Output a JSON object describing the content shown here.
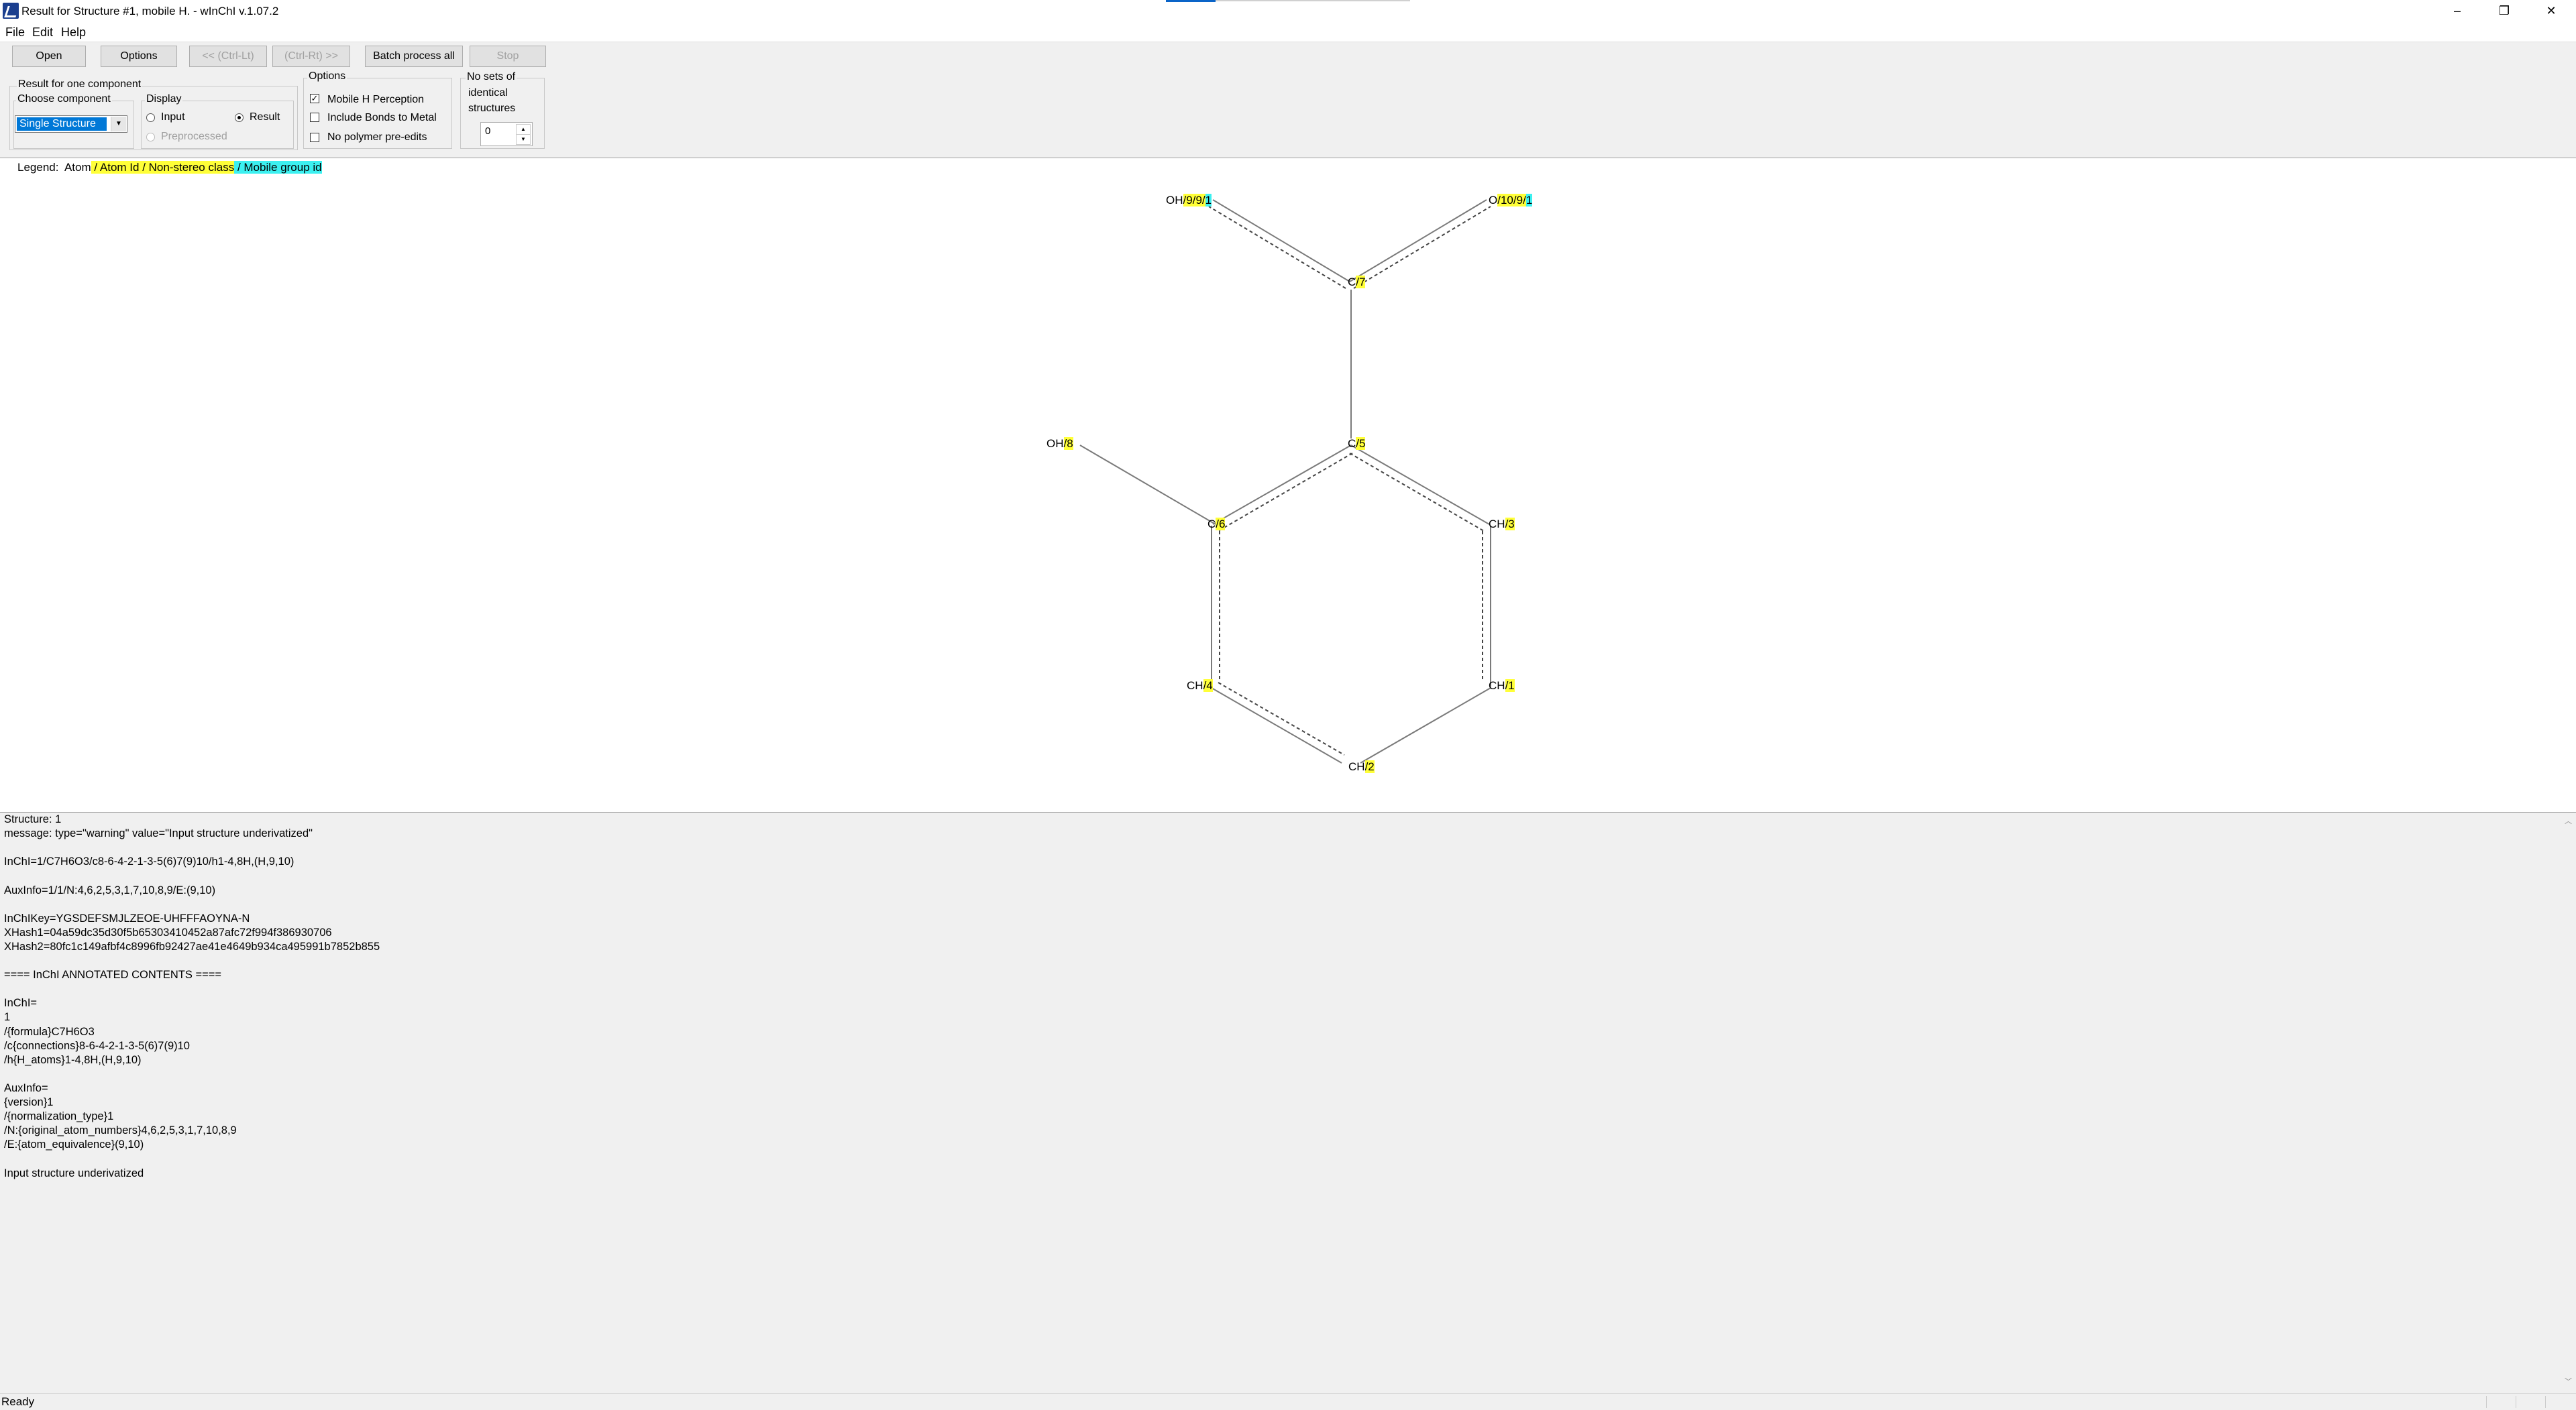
{
  "window": {
    "title": "Result for Structure #1, mobile H. - wInChI v.1.07.2",
    "minimize": "–",
    "restore": "❐",
    "close": "✕"
  },
  "menu": [
    "File",
    "Edit",
    "Help"
  ],
  "toolbar": {
    "open": "Open",
    "options": "Options",
    "prev": "<< (Ctrl-Lt)",
    "next": "(Ctrl-Rt) >>",
    "batch": "Batch process all",
    "stop": "Stop"
  },
  "result_group": {
    "title": "Result for one component",
    "choose_label": "Choose component",
    "combo_value": "Single Structure"
  },
  "display_group": {
    "title": "Display",
    "input": "Input",
    "result": "Result",
    "preprocessed": "Preprocessed",
    "selected": "Result"
  },
  "options_group": {
    "title": "Options",
    "mobile_h": "Mobile H Perception",
    "mobile_h_checked": true,
    "bonds_metal": "Include Bonds to Metal",
    "bonds_metal_checked": false,
    "no_polymer": "No polymer pre-edits",
    "no_polymer_checked": false
  },
  "identical_group": {
    "line1": "No sets of",
    "line2": "identical",
    "line3": "structures",
    "spin_value": "0"
  },
  "legend": {
    "label": "Legend:",
    "atom": "Atom",
    "sep1": " / ",
    "atom_id": "Atom Id",
    "sep2": " / ",
    "non_stereo": "Non-stereo class",
    "sep3": " / ",
    "mobile_group": "Mobile group id"
  },
  "atoms": [
    {
      "key": "oh9",
      "symbol": "OH",
      "parts": [
        "9",
        "9",
        "1"
      ]
    },
    {
      "key": "o10",
      "symbol": "O",
      "parts": [
        "10",
        "9",
        "1"
      ]
    },
    {
      "key": "c7",
      "symbol": "C",
      "parts": [
        "7"
      ]
    },
    {
      "key": "oh8",
      "symbol": "OH",
      "parts": [
        "8"
      ]
    },
    {
      "key": "c5",
      "symbol": "C",
      "parts": [
        "5"
      ]
    },
    {
      "key": "c6",
      "symbol": "C",
      "parts": [
        "6"
      ]
    },
    {
      "key": "ch3",
      "symbol": "CH",
      "parts": [
        "3"
      ]
    },
    {
      "key": "ch4",
      "symbol": "CH",
      "parts": [
        "4"
      ]
    },
    {
      "key": "ch1",
      "symbol": "CH",
      "parts": [
        "1"
      ]
    },
    {
      "key": "ch2",
      "symbol": "CH",
      "parts": [
        "2"
      ]
    }
  ],
  "output_lines": [
    "Structure: 1",
    "message: type=\"warning\" value=\"Input structure underivatized\"",
    "",
    "InChI=1/C7H6O3/c8-6-4-2-1-3-5(6)7(9)10/h1-4,8H,(H,9,10)",
    "",
    "AuxInfo=1/1/N:4,6,2,5,3,1,7,10,8,9/E:(9,10)",
    "",
    "InChIKey=YGSDEFSMJLZEOE-UHFFFAOYNA-N",
    "XHash1=04a59dc35d30f5b65303410452a87afc72f994f386930706",
    "XHash2=80fc1c149afbf4c8996fb92427ae41e4649b934ca495991b7852b855",
    "",
    "==== InChI ANNOTATED CONTENTS ====",
    "",
    "InChI=",
    "1",
    "/{formula}C7H6O3",
    "/c{connections}8-6-4-2-1-3-5(6)7(9)10",
    "/h{H_atoms}1-4,8H,(H,9,10)",
    "",
    "AuxInfo=",
    "{version}1",
    "/{normalization_type}1",
    "/N:{original_atom_numbers}4,6,2,5,3,1,7,10,8,9",
    "/E:{atom_equivalence}(9,10)",
    "",
    "Input structure underivatized"
  ],
  "status": "Ready"
}
